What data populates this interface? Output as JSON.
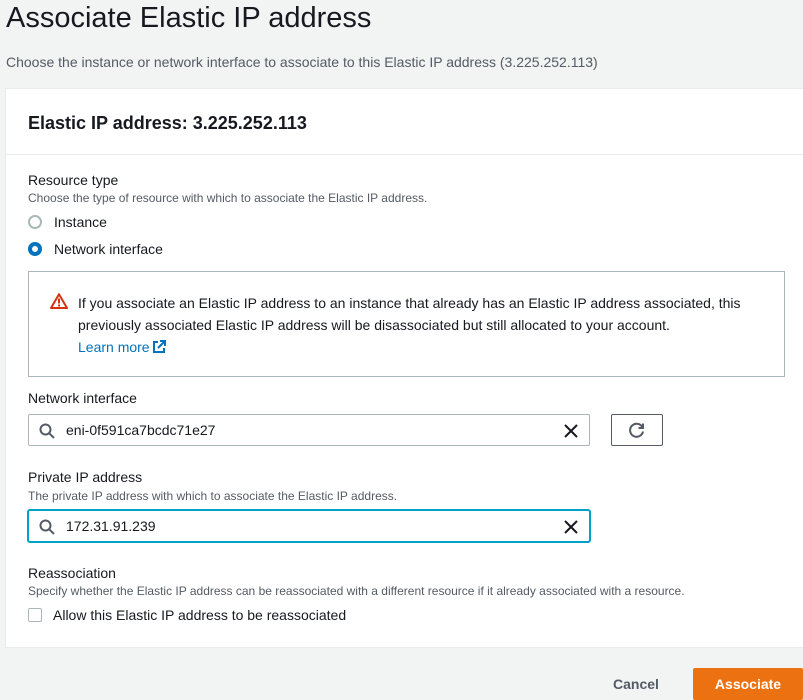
{
  "page": {
    "title": "Associate Elastic IP address",
    "description": "Choose the instance or network interface to associate to this Elastic IP address (3.225.252.113)"
  },
  "panel": {
    "header": "Elastic IP address: 3.225.252.113"
  },
  "resource_type": {
    "label": "Resource type",
    "hint": "Choose the type of resource with which to associate the Elastic IP address.",
    "options": [
      {
        "label": "Instance",
        "selected": false
      },
      {
        "label": "Network interface",
        "selected": true
      }
    ]
  },
  "alert": {
    "text": "If you associate an Elastic IP address to an instance that already has an Elastic IP address associated, this previously associated Elastic IP address will be disassociated but still allocated to your account.",
    "link": "Learn more",
    "icon": "warning-icon"
  },
  "network_interface": {
    "label": "Network interface",
    "value": "eni-0f591ca7bcdc71e27"
  },
  "private_ip": {
    "label": "Private IP address",
    "hint": "The private IP address with which to associate the Elastic IP address.",
    "value": "172.31.91.239"
  },
  "reassociation": {
    "label": "Reassociation",
    "hint": "Specify whether the Elastic IP address can be reassociated with a different resource if it already associated with a resource.",
    "checkbox_label": "Allow this Elastic IP address to be reassociated",
    "checked": false
  },
  "footer": {
    "cancel": "Cancel",
    "submit": "Associate"
  },
  "colors": {
    "accent": "#0073bb",
    "primary_button": "#ec7211",
    "warning": "#d13212",
    "focus": "#00a1c9"
  }
}
